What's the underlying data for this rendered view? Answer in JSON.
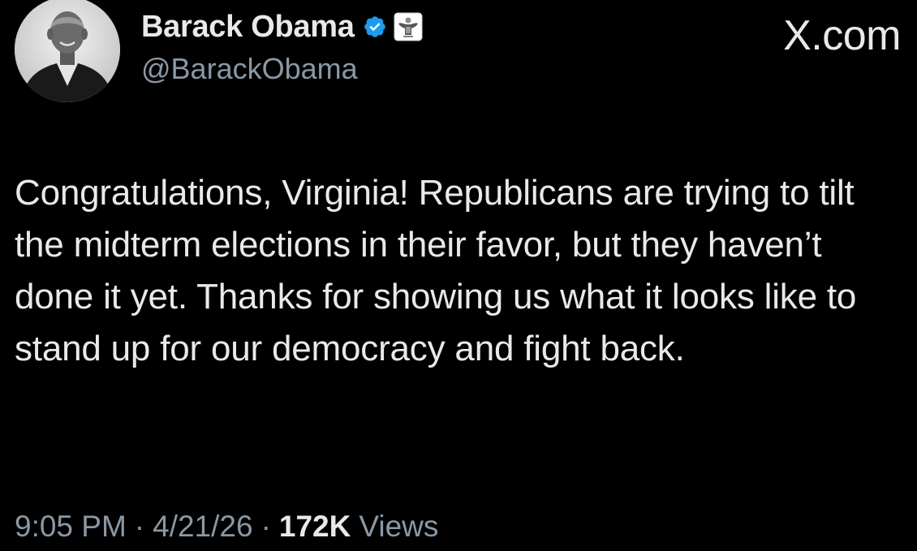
{
  "author": {
    "name": "Barack Obama",
    "handle": "@BarackObama",
    "verified_icon": "verified-badge-icon",
    "affiliation_icon": "government-seal-icon",
    "verified_color": "#1d9bf0"
  },
  "brand": {
    "label": "X.com"
  },
  "tweet": {
    "text": "Congratulations, Virginia! Republicans are trying to tilt the midterm elections in their favor, but they haven’t done it yet. Thanks for showing us what it looks like to stand up for our democracy and fight back."
  },
  "meta": {
    "time": "9:05 PM",
    "separator": "·",
    "date": "4/21/26",
    "views_count": "172K",
    "views_label": "Views"
  },
  "colors": {
    "background": "#000000",
    "primary_text": "#e7e9ea",
    "secondary_text": "#8b98a5"
  }
}
